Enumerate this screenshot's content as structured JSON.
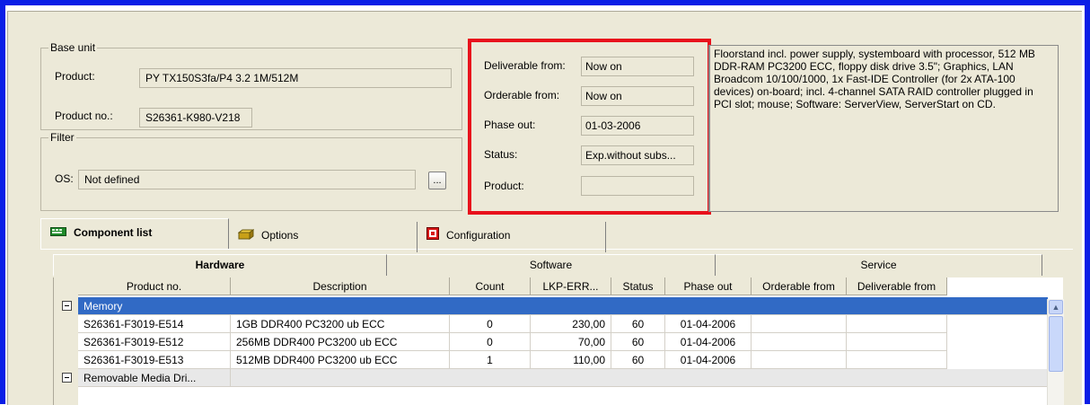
{
  "base_unit": {
    "legend": "Base unit",
    "product_label": "Product:",
    "product_value": "PY TX150S3fa/P4 3.2 1M/512M",
    "product_no_label": "Product no.:",
    "product_no_value": "S26361-K980-V218"
  },
  "filter": {
    "legend": "Filter",
    "os_label": "OS:",
    "os_value": "Not defined",
    "browse_label": "..."
  },
  "availability": {
    "deliverable_label": "Deliverable from:",
    "deliverable_value": "Now on",
    "orderable_label": "Orderable from:",
    "orderable_value": "Now on",
    "phase_out_label": "Phase out:",
    "phase_out_value": "01-03-2006",
    "status_label": "Status:",
    "status_value": "Exp.without subs...",
    "product_label": "Product:",
    "product_value": ""
  },
  "description": "Floorstand incl. power supply, systemboard with processor, 512 MB DDR-RAM PC3200 ECC, floppy disk drive 3.5\"; Graphics, LAN Broadcom 10/100/1000, 1x Fast-IDE Controller (for 2x ATA-100 devices) on-board; incl. 4-channel SATA RAID controller plugged in PCI slot; mouse; Software: ServerView, ServerStart on CD.",
  "tabs": [
    {
      "label": "Component list",
      "icon": "component-list-icon"
    },
    {
      "label": "Options",
      "icon": "options-icon"
    },
    {
      "label": "Configuration",
      "icon": "configuration-icon"
    }
  ],
  "subtabs": [
    "Hardware",
    "Software",
    "Service"
  ],
  "table": {
    "columns": [
      "Product no.",
      "Description",
      "Count",
      "LKP-ERR...",
      "Status",
      "Phase out",
      "Orderable from",
      "Deliverable from"
    ],
    "group1": "Memory",
    "rows": [
      [
        "S26361-F3019-E514",
        "1GB DDR400 PC3200 ub ECC",
        "0",
        "230,00",
        "60",
        "01-04-2006",
        "",
        ""
      ],
      [
        "S26361-F3019-E512",
        "256MB DDR400 PC3200 ub ECC",
        "0",
        "70,00",
        "60",
        "01-04-2006",
        "",
        ""
      ],
      [
        "S26361-F3019-E513",
        "512MB DDR400 PC3200 ub ECC",
        "1",
        "110,00",
        "60",
        "01-04-2006",
        "",
        ""
      ]
    ],
    "group2": "Removable Media Dri..."
  },
  "colors": {
    "frame": "#0a1ee6",
    "highlight": "#e8101c",
    "selection": "#316ac5"
  }
}
